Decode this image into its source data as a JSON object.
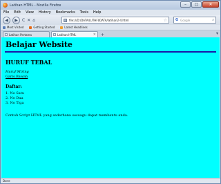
{
  "window": {
    "title": "Latihan HTML - Mozilla Firefox",
    "minimize": "–",
    "maximize": "□",
    "close": "✕"
  },
  "menu": [
    "File",
    "Edit",
    "View",
    "History",
    "Bookmarks",
    "Tools",
    "Help"
  ],
  "nav": {
    "back": "◀",
    "forward": "▶",
    "reload": "C",
    "stop": "✕",
    "home": "⌂",
    "url": "file:///D:/DATA/LUTHFI/DATA/latihan2-4.html",
    "star": "☆",
    "search_engine": "G",
    "search_placeholder": "Google",
    "search_glyph": "⌕"
  },
  "bookmarks": [
    {
      "label": "Most Visited",
      "icon_color": "#5a7fb8"
    },
    {
      "label": "Getting Started",
      "icon_color": "#e76b17"
    },
    {
      "label": "Latest Headlines",
      "icon_color": "#f0a030"
    }
  ],
  "tabs": [
    {
      "label": "Latihan Pertama",
      "active": false
    },
    {
      "label": "Latihan HTML",
      "active": true
    }
  ],
  "tab_controls": {
    "close": "×",
    "new": "+",
    "list": "▾"
  },
  "content": {
    "background": "#00ffff",
    "heading": "Belajar Website",
    "subheading": "HURUF TEBAL",
    "italic": "Huruf Miring",
    "underline": "Garis Bawah",
    "list_title": "Daftar:",
    "list_items": [
      "1. No Satu",
      "2. No Dua",
      "3. No Tiga"
    ],
    "footer": "Contoh Script HTML yang sederhana sesuagu dapat membantu anda."
  },
  "status": "Done"
}
